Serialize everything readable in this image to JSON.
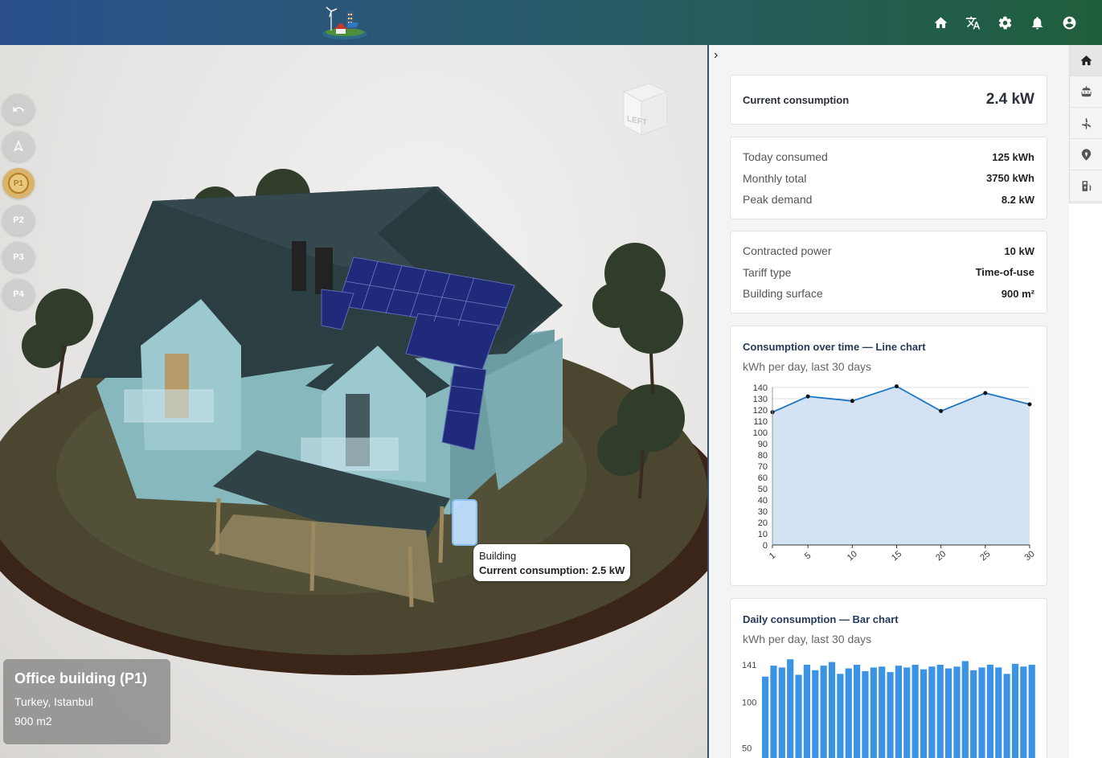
{
  "header": {
    "icons": [
      "home-icon",
      "translate-icon",
      "gear-icon",
      "bell-icon",
      "account-icon"
    ]
  },
  "tools": {
    "floors": [
      "P1",
      "P2",
      "P3",
      "P4"
    ],
    "active_floor": "P1",
    "cube_face": "LEFT"
  },
  "tooltip": {
    "name": "Building",
    "value": "Current consumption: 2.5 kW"
  },
  "location_card": {
    "title": "Office building (P1)",
    "location": "Turkey, Istanbul",
    "area": "900 m2"
  },
  "panel": {
    "current": {
      "label": "Current consumption",
      "value": "2.4 kW"
    },
    "stats1": [
      {
        "label": "Today consumed",
        "value": "125 kWh"
      },
      {
        "label": "Monthly total",
        "value": "3750 kWh"
      },
      {
        "label": "Peak demand",
        "value": "8.2 kW"
      }
    ],
    "stats2": [
      {
        "label": "Contracted power",
        "value": "10 kW"
      },
      {
        "label": "Tariff type",
        "value": "Time-of-use"
      },
      {
        "label": "Building surface",
        "value": "900 m²"
      }
    ]
  },
  "right_tabs": [
    "home-icon",
    "solar-panel-icon",
    "wind-icon",
    "location-pin-icon",
    "ev-charger-icon"
  ],
  "chart_data": [
    {
      "type": "line",
      "title": "Consumption over time — Line chart",
      "subtitle": "kWh per day, last 30 days",
      "x": [
        1,
        5,
        10,
        15,
        20,
        25,
        30
      ],
      "series": [
        {
          "values": [
            118,
            132,
            128,
            141,
            119,
            135,
            125
          ]
        }
      ],
      "xticks": [
        "1",
        "5",
        "10",
        "15",
        "20",
        "25",
        "30"
      ],
      "yticks": [
        0,
        10,
        20,
        30,
        40,
        50,
        60,
        70,
        80,
        90,
        100,
        110,
        120,
        130,
        140
      ],
      "ylim": [
        0,
        140
      ],
      "color": "#1f77c4",
      "fill": "#cfe0f3"
    },
    {
      "type": "bar",
      "title": "Daily consumption — Bar chart",
      "subtitle": "kWh per day, last 30 days",
      "values": [
        128,
        140,
        138,
        147,
        130,
        141,
        135,
        140,
        144,
        131,
        137,
        141,
        134,
        138,
        139,
        133,
        140,
        138,
        141,
        136,
        139,
        141,
        137,
        139,
        145,
        135,
        138,
        141,
        138,
        131,
        142,
        139,
        141
      ],
      "yticks": [
        50,
        100,
        141
      ],
      "ylim": [
        0,
        141
      ],
      "color": "#3b93e6"
    }
  ]
}
